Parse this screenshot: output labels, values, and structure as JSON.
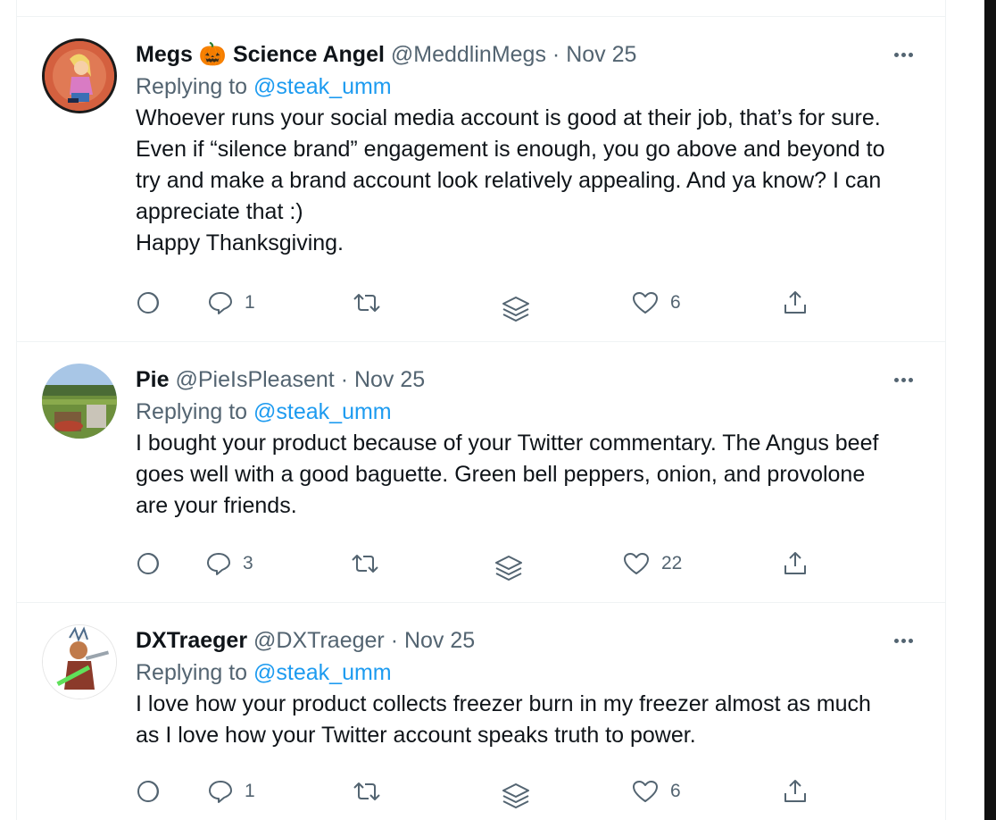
{
  "tweets": [
    {
      "name": "Megs",
      "name_emoji": "🎃",
      "name_suffix": "Science Angel",
      "handle": "@MeddlinMegs",
      "date": "Nov 25",
      "replying_label": "Replying to",
      "replying_to": "@steak_umm",
      "text_lines": [
        "Whoever runs your social media account is good at their job, that’s for sure.",
        "Even if “silence brand” engagement is enough, you go above and beyond to",
        "try and make a brand account look relatively appealing. And ya know? I can",
        "appreciate that :)",
        "Happy Thanksgiving."
      ],
      "replies": "1",
      "likes": "6"
    },
    {
      "name": "Pie",
      "handle": "@PieIsPleasent",
      "date": "Nov 25",
      "replying_label": "Replying to",
      "replying_to": "@steak_umm",
      "text_lines": [
        "I bought your product because of your Twitter commentary. The Angus beef",
        "goes well with a good baguette. Green bell peppers, onion, and provolone",
        "are your friends."
      ],
      "replies": "3",
      "likes": "22"
    },
    {
      "name": "DXTraeger",
      "handle": "@DXTraeger",
      "date": "Nov 25",
      "replying_label": "Replying to",
      "replying_to": "@steak_umm",
      "text_lines": [
        "I love how your product collects freezer burn in my freezer almost as much",
        "as I love how your Twitter account speaks truth to power."
      ],
      "replies": "1",
      "likes": "6"
    }
  ],
  "separator": "·",
  "icons": {
    "analytics": "circle-slice-icon",
    "reply": "speech-bubble-icon",
    "retweet": "retweet-icon",
    "stack": "layers-icon",
    "like": "heart-icon",
    "share": "share-icon",
    "more": "more-dots-icon"
  },
  "colors": {
    "text": "#0f1419",
    "secondary": "#536471",
    "link": "#1d9bf0",
    "border": "#eff3f4"
  }
}
